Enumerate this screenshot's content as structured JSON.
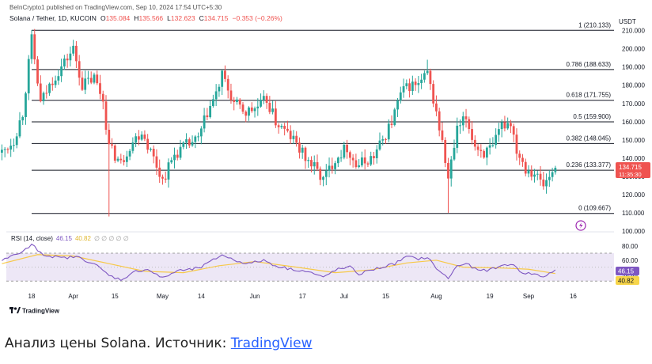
{
  "header": {
    "published": "BeInCrypto1 published on TradingView.com, Sep 10, 2024 17:54 UTC+5:30",
    "symbol": "Solana / Tether, 1D, KUCOIN",
    "o_label": "O",
    "o_value": "135.084",
    "h_label": "H",
    "h_value": "135.566",
    "l_label": "L",
    "l_value": "132.623",
    "c_label": "C",
    "c_value": "134.715",
    "change": "−0.353 (−0.26%)",
    "currency": "USDT"
  },
  "colors": {
    "up": "#26a69a",
    "down": "#ef5350",
    "rsi_line": "#7e57c2",
    "rsi_ma": "#f7c948",
    "rsi_band": "#ede7f6",
    "fib_line": "#131722",
    "brand": "#2962ff"
  },
  "icons": {
    "flash": "lightning-icon",
    "logo": "tradingview-logo-icon"
  },
  "price_badge": {
    "value": "134.715",
    "timer": "11:35:30"
  },
  "rsi_badges": {
    "rsi": "46.15",
    "ma": "40.82"
  },
  "logo_text": "TradingView",
  "caption": {
    "text": "Анализ цены Solana. Источник: ",
    "link": "TradingView"
  },
  "chart_data": [
    {
      "type": "candlestick",
      "ylim": [
        100,
        212
      ],
      "y_ticks": [
        "210.000",
        "200.000",
        "190.000",
        "180.000",
        "170.000",
        "160.000",
        "150.000",
        "140.000",
        "130.000",
        "120.000",
        "110.000",
        "100.000"
      ],
      "x_ticks": [
        {
          "label": "18",
          "date": "2024-03-18"
        },
        {
          "label": "Apr",
          "date": "2024-04-01"
        },
        {
          "label": "15",
          "date": "2024-04-15"
        },
        {
          "label": "May",
          "date": "2024-05-01"
        },
        {
          "label": "14",
          "date": "2024-05-14"
        },
        {
          "label": "Jun",
          "date": "2024-06-01"
        },
        {
          "label": "17",
          "date": "2024-06-17"
        },
        {
          "label": "Jul",
          "date": "2024-07-01"
        },
        {
          "label": "15",
          "date": "2024-07-15"
        },
        {
          "label": "Aug",
          "date": "2024-08-01"
        },
        {
          "label": "19",
          "date": "2024-08-19"
        },
        {
          "label": "Sep",
          "date": "2024-09-01"
        },
        {
          "label": "16",
          "date": "2024-09-16"
        }
      ],
      "fib_levels": [
        {
          "label": "1 (210.133)",
          "value": 210.133
        },
        {
          "label": "0.786 (188.633)",
          "value": 188.633
        },
        {
          "label": "0.618 (171.755)",
          "value": 171.755
        },
        {
          "label": "0.5 (159.900)",
          "value": 159.9
        },
        {
          "label": "0.382 (148.045)",
          "value": 148.045
        },
        {
          "label": "0.236 (133.377)",
          "value": 133.377
        },
        {
          "label": "0 (109.667)",
          "value": 109.667
        }
      ],
      "path": [
        {
          "date": "2024-03-08",
          "price": 143
        },
        {
          "date": "2024-03-12",
          "price": 150
        },
        {
          "date": "2024-03-15",
          "price": 165
        },
        {
          "date": "2024-03-18",
          "price": 205
        },
        {
          "date": "2024-03-21",
          "price": 170
        },
        {
          "date": "2024-03-25",
          "price": 183
        },
        {
          "date": "2024-03-28",
          "price": 190
        },
        {
          "date": "2024-04-01",
          "price": 200
        },
        {
          "date": "2024-04-04",
          "price": 180
        },
        {
          "date": "2024-04-08",
          "price": 184
        },
        {
          "date": "2024-04-11",
          "price": 172
        },
        {
          "date": "2024-04-13",
          "price": 146
        },
        {
          "date": "2024-04-17",
          "price": 137
        },
        {
          "date": "2024-04-20",
          "price": 147
        },
        {
          "date": "2024-04-24",
          "price": 155
        },
        {
          "date": "2024-04-28",
          "price": 140
        },
        {
          "date": "2024-05-01",
          "price": 128
        },
        {
          "date": "2024-05-05",
          "price": 142
        },
        {
          "date": "2024-05-09",
          "price": 147
        },
        {
          "date": "2024-05-13",
          "price": 150
        },
        {
          "date": "2024-05-16",
          "price": 165
        },
        {
          "date": "2024-05-19",
          "price": 175
        },
        {
          "date": "2024-05-21",
          "price": 185
        },
        {
          "date": "2024-05-25",
          "price": 170
        },
        {
          "date": "2024-05-29",
          "price": 165
        },
        {
          "date": "2024-06-02",
          "price": 168
        },
        {
          "date": "2024-06-05",
          "price": 172
        },
        {
          "date": "2024-06-08",
          "price": 160
        },
        {
          "date": "2024-06-11",
          "price": 155
        },
        {
          "date": "2024-06-14",
          "price": 150
        },
        {
          "date": "2024-06-18",
          "price": 140
        },
        {
          "date": "2024-06-21",
          "price": 135
        },
        {
          "date": "2024-06-24",
          "price": 128
        },
        {
          "date": "2024-06-28",
          "price": 140
        },
        {
          "date": "2024-07-02",
          "price": 146
        },
        {
          "date": "2024-07-05",
          "price": 136
        },
        {
          "date": "2024-07-08",
          "price": 138
        },
        {
          "date": "2024-07-11",
          "price": 141
        },
        {
          "date": "2024-07-14",
          "price": 150
        },
        {
          "date": "2024-07-17",
          "price": 160
        },
        {
          "date": "2024-07-20",
          "price": 175
        },
        {
          "date": "2024-07-23",
          "price": 180
        },
        {
          "date": "2024-07-26",
          "price": 180
        },
        {
          "date": "2024-07-29",
          "price": 186
        },
        {
          "date": "2024-08-01",
          "price": 165
        },
        {
          "date": "2024-08-03",
          "price": 148
        },
        {
          "date": "2024-08-05",
          "price": 128
        },
        {
          "date": "2024-08-08",
          "price": 155
        },
        {
          "date": "2024-08-11",
          "price": 162
        },
        {
          "date": "2024-08-14",
          "price": 147
        },
        {
          "date": "2024-08-17",
          "price": 143
        },
        {
          "date": "2024-08-20",
          "price": 145
        },
        {
          "date": "2024-08-23",
          "price": 158
        },
        {
          "date": "2024-08-26",
          "price": 160
        },
        {
          "date": "2024-08-28",
          "price": 145
        },
        {
          "date": "2024-08-31",
          "price": 135
        },
        {
          "date": "2024-09-03",
          "price": 132
        },
        {
          "date": "2024-09-06",
          "price": 125
        },
        {
          "date": "2024-09-08",
          "price": 130
        },
        {
          "date": "2024-09-10",
          "price": 134.7
        }
      ],
      "wick_extremes": [
        {
          "date": "2024-04-13",
          "low": 108
        },
        {
          "date": "2024-08-05",
          "low": 110
        },
        {
          "date": "2024-07-29",
          "high": 194
        }
      ]
    },
    {
      "type": "line",
      "title": "RSI (14, close)",
      "rsi_value": "46.15",
      "ma_value": "40.82",
      "ylim": [
        20,
        95
      ],
      "band": [
        30,
        70
      ],
      "y_ticks": [
        "80.00",
        "60.00",
        "40.00"
      ],
      "series": [
        {
          "name": "RSI",
          "points": [
            {
              "date": "2024-03-08",
              "value": 60
            },
            {
              "date": "2024-03-15",
              "value": 72
            },
            {
              "date": "2024-03-18",
              "value": 82
            },
            {
              "date": "2024-03-22",
              "value": 68
            },
            {
              "date": "2024-03-28",
              "value": 63
            },
            {
              "date": "2024-04-02",
              "value": 65
            },
            {
              "date": "2024-04-08",
              "value": 55
            },
            {
              "date": "2024-04-13",
              "value": 38
            },
            {
              "date": "2024-04-17",
              "value": 32
            },
            {
              "date": "2024-04-22",
              "value": 44
            },
            {
              "date": "2024-04-26",
              "value": 47
            },
            {
              "date": "2024-05-01",
              "value": 34
            },
            {
              "date": "2024-05-06",
              "value": 45
            },
            {
              "date": "2024-05-10",
              "value": 46
            },
            {
              "date": "2024-05-14",
              "value": 50
            },
            {
              "date": "2024-05-18",
              "value": 60
            },
            {
              "date": "2024-05-21",
              "value": 68
            },
            {
              "date": "2024-05-25",
              "value": 60
            },
            {
              "date": "2024-05-30",
              "value": 55
            },
            {
              "date": "2024-06-04",
              "value": 60
            },
            {
              "date": "2024-06-08",
              "value": 52
            },
            {
              "date": "2024-06-12",
              "value": 48
            },
            {
              "date": "2024-06-17",
              "value": 45
            },
            {
              "date": "2024-06-20",
              "value": 42
            },
            {
              "date": "2024-06-24",
              "value": 35
            },
            {
              "date": "2024-06-28",
              "value": 46
            },
            {
              "date": "2024-07-03",
              "value": 50
            },
            {
              "date": "2024-07-06",
              "value": 40
            },
            {
              "date": "2024-07-10",
              "value": 46
            },
            {
              "date": "2024-07-14",
              "value": 50
            },
            {
              "date": "2024-07-18",
              "value": 55
            },
            {
              "date": "2024-07-22",
              "value": 65
            },
            {
              "date": "2024-07-26",
              "value": 62
            },
            {
              "date": "2024-07-29",
              "value": 64
            },
            {
              "date": "2024-08-02",
              "value": 44
            },
            {
              "date": "2024-08-05",
              "value": 34
            },
            {
              "date": "2024-08-08",
              "value": 52
            },
            {
              "date": "2024-08-11",
              "value": 55
            },
            {
              "date": "2024-08-15",
              "value": 45
            },
            {
              "date": "2024-08-19",
              "value": 46
            },
            {
              "date": "2024-08-23",
              "value": 52
            },
            {
              "date": "2024-08-26",
              "value": 55
            },
            {
              "date": "2024-08-30",
              "value": 42
            },
            {
              "date": "2024-09-03",
              "value": 40
            },
            {
              "date": "2024-09-06",
              "value": 36
            },
            {
              "date": "2024-09-10",
              "value": 46.15
            }
          ]
        },
        {
          "name": "RSI-based MA",
          "points": [
            {
              "date": "2024-03-08",
              "value": 55
            },
            {
              "date": "2024-03-20",
              "value": 68
            },
            {
              "date": "2024-04-01",
              "value": 66
            },
            {
              "date": "2024-04-13",
              "value": 55
            },
            {
              "date": "2024-04-25",
              "value": 44
            },
            {
              "date": "2024-05-08",
              "value": 42
            },
            {
              "date": "2024-05-20",
              "value": 52
            },
            {
              "date": "2024-06-01",
              "value": 58
            },
            {
              "date": "2024-06-15",
              "value": 50
            },
            {
              "date": "2024-06-28",
              "value": 42
            },
            {
              "date": "2024-07-10",
              "value": 46
            },
            {
              "date": "2024-07-22",
              "value": 56
            },
            {
              "date": "2024-08-01",
              "value": 60
            },
            {
              "date": "2024-08-10",
              "value": 50
            },
            {
              "date": "2024-08-22",
              "value": 49
            },
            {
              "date": "2024-09-01",
              "value": 47
            },
            {
              "date": "2024-09-10",
              "value": 40.82
            }
          ]
        }
      ]
    }
  ]
}
